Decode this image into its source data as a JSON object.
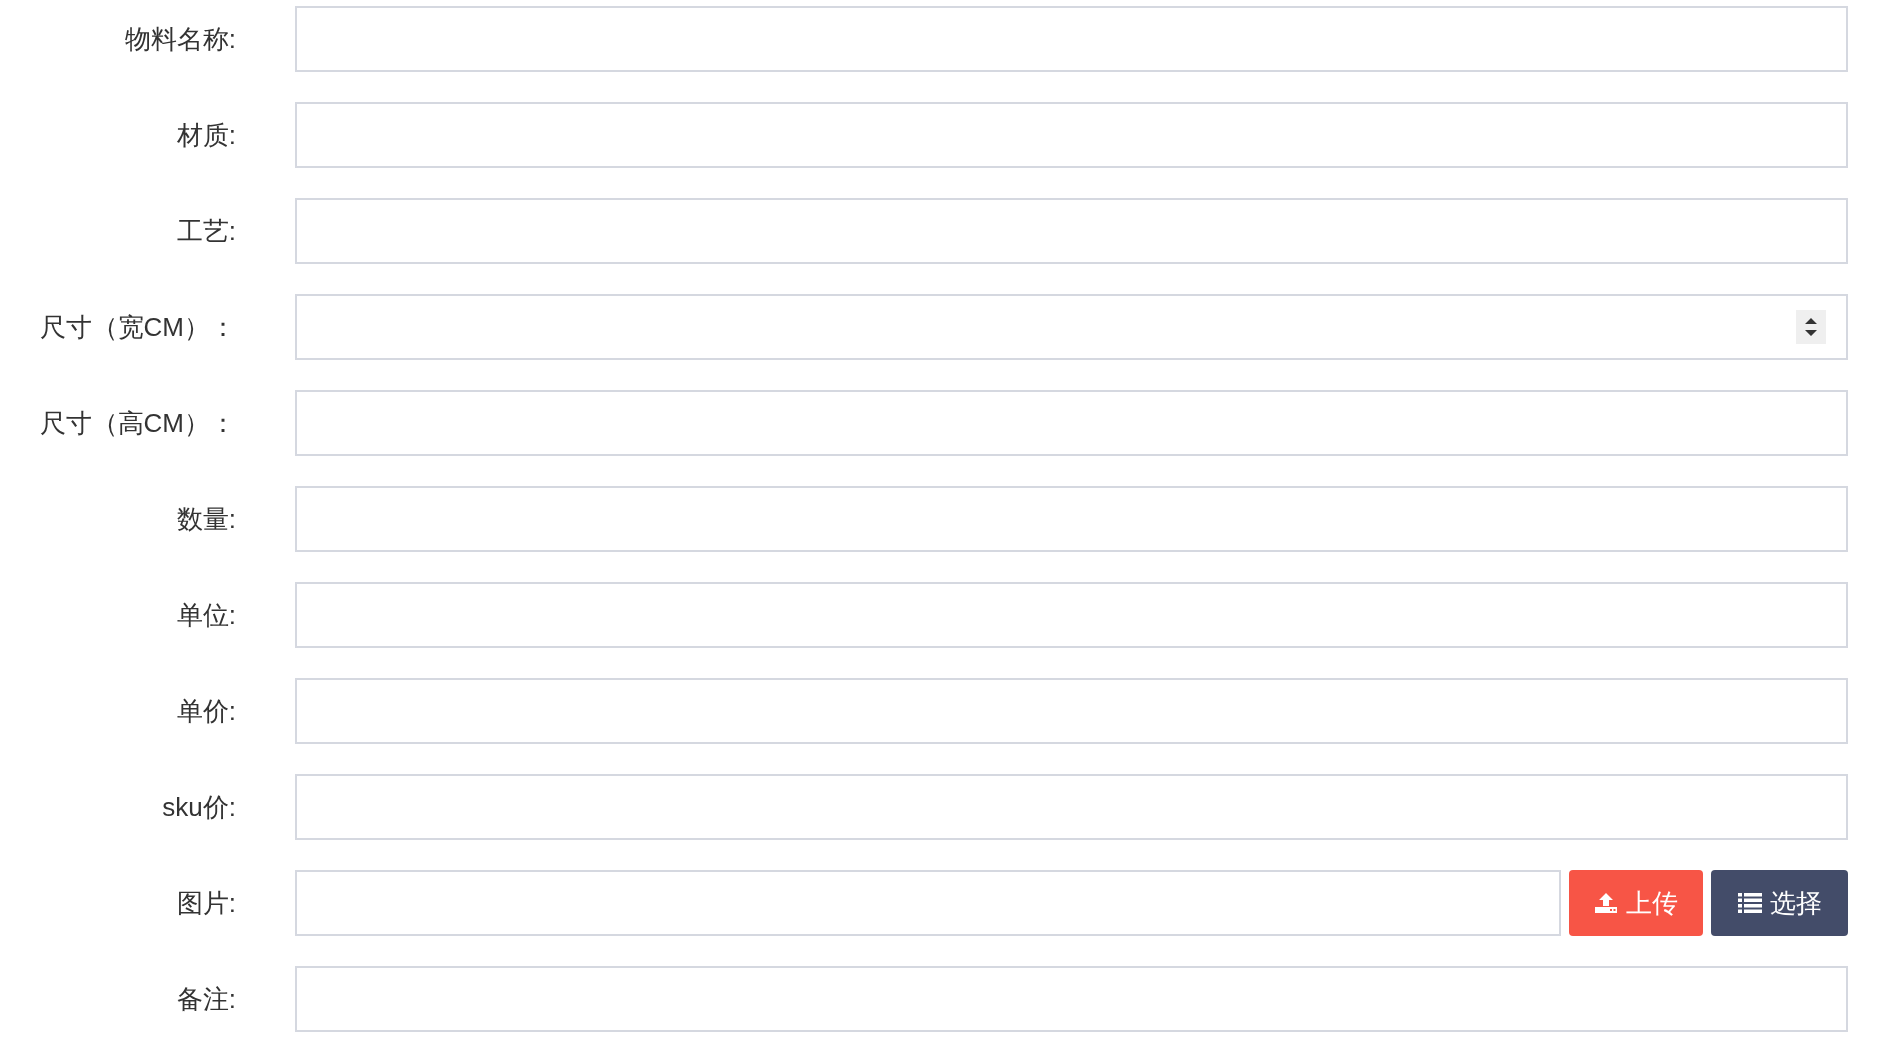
{
  "fields": [
    {
      "label": "物料名称:",
      "kind": "text"
    },
    {
      "label": "材质:",
      "kind": "text"
    },
    {
      "label": "工艺:",
      "kind": "text"
    },
    {
      "label": "尺寸（宽CM）：",
      "kind": "number"
    },
    {
      "label": "尺寸（高CM）：",
      "kind": "text"
    },
    {
      "label": "数量:",
      "kind": "text"
    },
    {
      "label": "单位:",
      "kind": "text"
    },
    {
      "label": "单价:",
      "kind": "text"
    },
    {
      "label": "sku价:",
      "kind": "text"
    },
    {
      "label": "图片:",
      "kind": "image",
      "buttons": [
        {
          "label": "上传",
          "kind": "upload"
        },
        {
          "label": "选择",
          "kind": "select"
        }
      ]
    },
    {
      "label": "备注:",
      "kind": "text"
    }
  ]
}
